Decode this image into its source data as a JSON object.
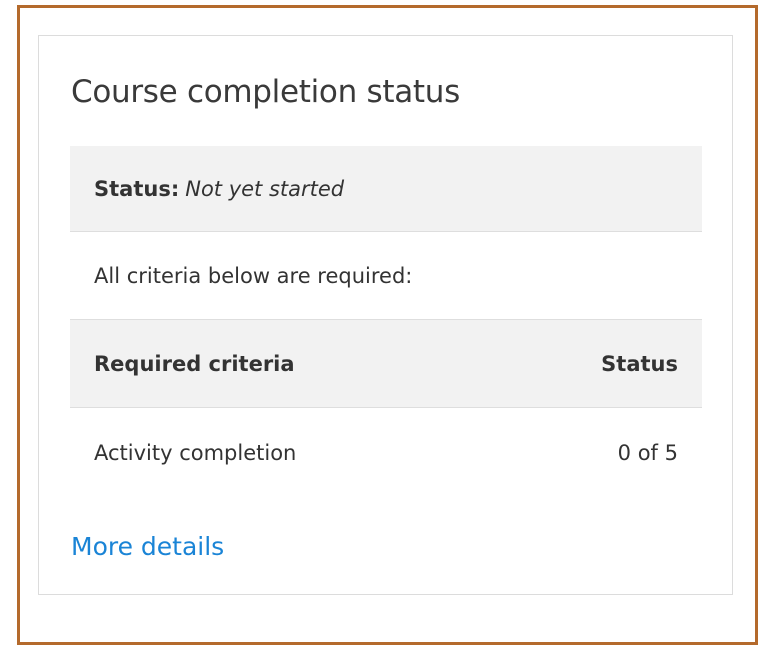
{
  "block": {
    "title": "Course completion status",
    "status_label": "Status:",
    "status_value": "Not yet started",
    "requirement_note": "All criteria below are required:",
    "table": {
      "headers": [
        "Required criteria",
        "Status"
      ],
      "rows": [
        {
          "criteria": "Activity completion",
          "status": "0 of 5"
        }
      ]
    },
    "more_details_label": "More details"
  },
  "colors": {
    "frame_border": "#b46a2c",
    "link": "#1a84d6",
    "shaded_row": "#f2f2f2"
  }
}
